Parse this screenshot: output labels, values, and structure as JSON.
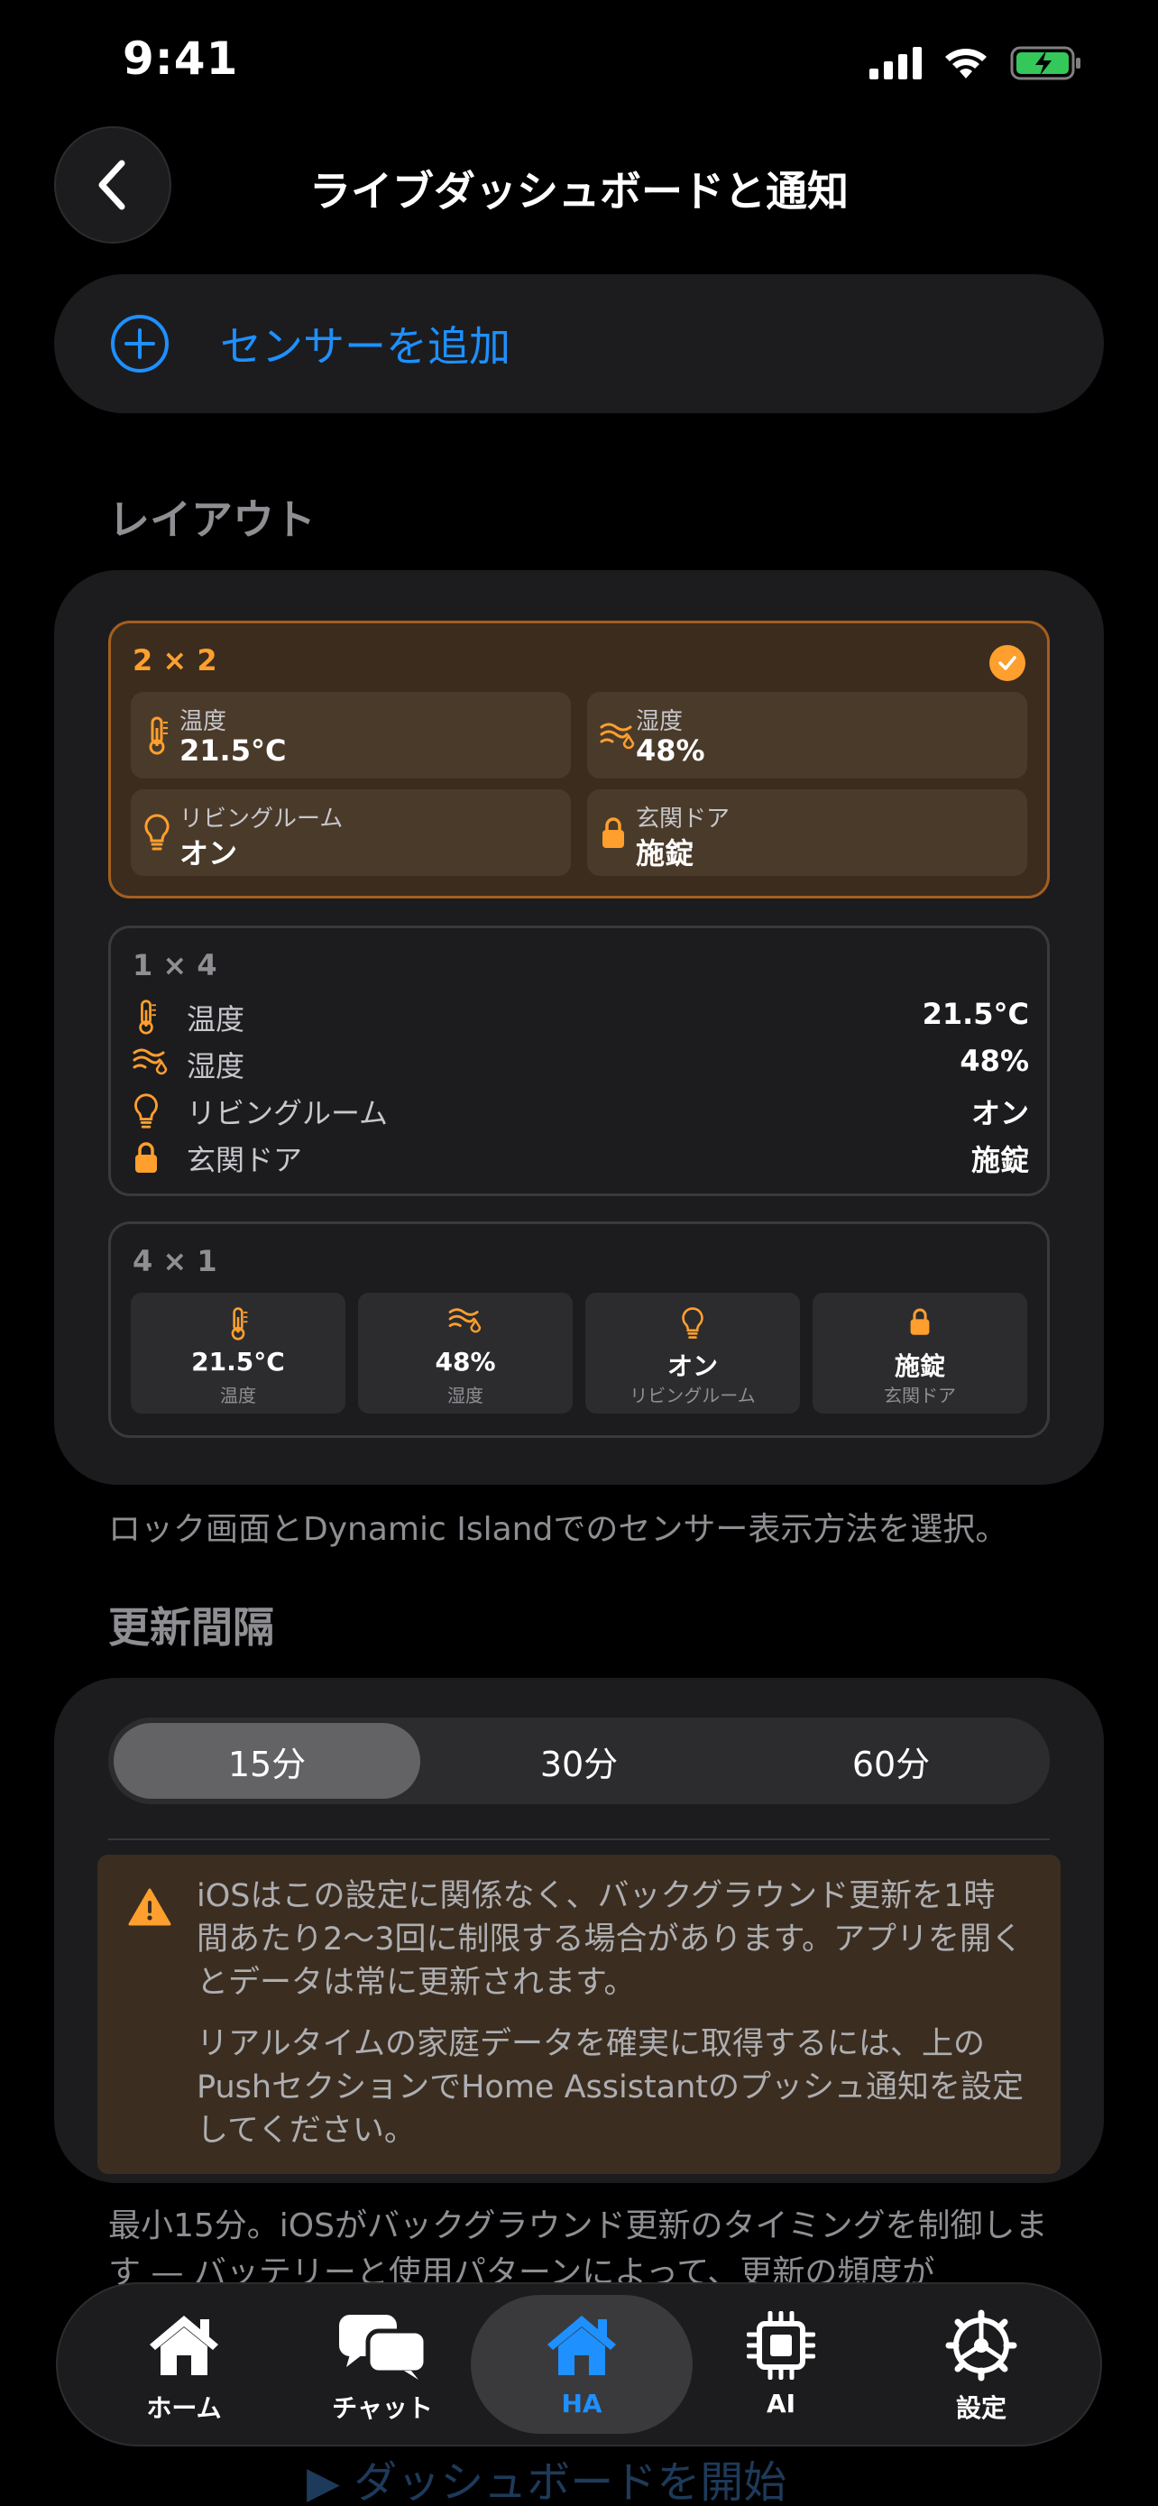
{
  "status_bar": {
    "time": "9:41"
  },
  "header": {
    "title": "ライブダッシュボードと通知"
  },
  "add_sensor": {
    "label": "センサーを追加"
  },
  "layout": {
    "section_title": "レイアウト",
    "options": {
      "grid": {
        "title": "2 × 2",
        "tiles": [
          {
            "label": "温度",
            "value": "21.5°C"
          },
          {
            "label": "湿度",
            "value": "48%"
          },
          {
            "label": "リビングルーム",
            "value": "オン"
          },
          {
            "label": "玄関ドア",
            "value": "施錠"
          }
        ]
      },
      "list": {
        "title": "1 × 4",
        "rows": [
          {
            "label": "温度",
            "value": "21.5°C"
          },
          {
            "label": "湿度",
            "value": "48%"
          },
          {
            "label": "リビングルーム",
            "value": "オン"
          },
          {
            "label": "玄関ドア",
            "value": "施錠"
          }
        ]
      },
      "columns": {
        "title": "4 × 1",
        "cols": [
          {
            "label": "温度",
            "value": "21.5°C"
          },
          {
            "label": "湿度",
            "value": "48%"
          },
          {
            "label": "リビングルーム",
            "value": "オン"
          },
          {
            "label": "玄関ドア",
            "value": "施錠"
          }
        ]
      }
    },
    "caption": "ロック画面とDynamic Islandでのセンサー表示方法を選択。"
  },
  "interval": {
    "section_title": "更新間隔",
    "options": [
      "15分",
      "30分",
      "60分"
    ],
    "selected": "15分",
    "warning": {
      "p1": "iOSはこの設定に関係なく、バックグラウンド更新を1時間あたり2〜3回に制限する場合があります。アプリを開くとデータは常に更新されます。",
      "p2": "リアルタイムの家庭データを確実に取得するには、上のPushセクションでHome Assistantのプッシュ通知を設定してください。"
    },
    "caption": "最小15分。iOSがバックグラウンド更新のタイミングを制御します — バッテリーと使用パターンによって、更新の頻度が"
  },
  "tabbar": {
    "tabs": [
      {
        "label": "ホーム",
        "icon": "house-icon"
      },
      {
        "label": "チャット",
        "icon": "chat-bubbles-icon"
      },
      {
        "label": "HA",
        "icon": "home-assistant-icon"
      },
      {
        "label": "AI",
        "icon": "chip-icon"
      },
      {
        "label": "設定",
        "icon": "gear-icon"
      }
    ],
    "active": "HA"
  },
  "behind": {
    "start_button": "ダッシュボードを開始"
  },
  "colors": {
    "accent": "#1e90ff",
    "orange": "#ff9f2e",
    "background": "#000000",
    "card": "#1c1c1e"
  }
}
